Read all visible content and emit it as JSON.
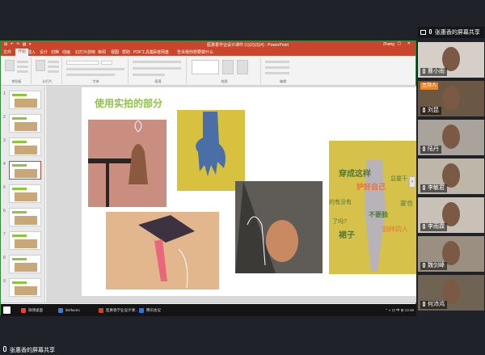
{
  "share_banner": {
    "text": "张惠香的屏幕共享"
  },
  "participants_panel": {
    "share_label": "张惠香的屏幕共享",
    "host_badge": "主持人",
    "participants": [
      {
        "name": "曹小雨",
        "bg": "#d5cfc8"
      },
      {
        "name": "刘昆",
        "bg": "#6b5844"
      },
      {
        "name": "陆丹",
        "bg": "#a9a39b"
      },
      {
        "name": "李敏君",
        "bg": "#bfb6aa"
      },
      {
        "name": "李雨霖",
        "bg": "#c9c1b7"
      },
      {
        "name": "魏剑峰",
        "bg": "#9a8f80"
      },
      {
        "name": "何沛鸿",
        "bg": "#6f6353"
      }
    ]
  },
  "ppt": {
    "window_title": "医惠香学业设计课件 (1)(2)(3)(4) · PowerPoint",
    "user": "Zhang",
    "quick_access": "⊞ ↶ ↷ ▤ ▾",
    "tabs": [
      "文件",
      "开始",
      "插入",
      "设计",
      "切换",
      "动画",
      "幻灯片放映",
      "审阅",
      "视图",
      "帮助",
      "PDF工具集",
      "百度网盘",
      "告诉我你想要做什么"
    ],
    "active_tab": 1,
    "ribbon_groups": [
      "剪贴板",
      "幻灯片",
      "字体",
      "段落",
      "绘图",
      "编辑"
    ],
    "slide_count": 9,
    "selected_slide": 4,
    "slide": {
      "title": "使用实拍的部分",
      "overlay_lines": [
        "穿成这样",
        "显要干",
        "护好自己",
        "的有没有",
        "不要脸",
        "家也",
        "了吗?",
        "裙子",
        "别样的人"
      ]
    },
    "status_text": "幻灯片 第 4 张，共 9 张   中文(中国)",
    "status_right": "备注   批注   ▭ ▭ ▭   ━━━━━━━━ +  73%"
  },
  "taskbar": {
    "items": [
      {
        "label": "微博桌面",
        "color": "#e8443a"
      },
      {
        "label": "iDefaceo",
        "color": "#3b7bd4"
      },
      {
        "label": "医惠香学业设计课...",
        "color": "#c9462c"
      },
      {
        "label": "腾讯会议",
        "color": "#2e74e8"
      }
    ],
    "tray": "⌃ ◐ ⊡ 中 ⊞ 13:48"
  }
}
